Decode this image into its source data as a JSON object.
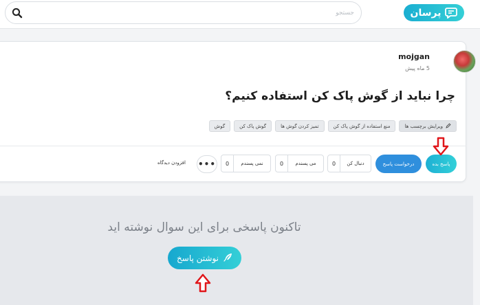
{
  "header": {
    "search_placeholder": "جستجو",
    "logo_text": "پرسان"
  },
  "question": {
    "author": "mojgan",
    "time": "5 ماه پیش",
    "title": "چرا نباید از گوش پاک کن استفاده کنیم؟",
    "tags": [
      "گوش",
      "گوش پاک کن",
      "تمیز کردن گوش ها",
      "منع استفاده از گوش پاک کن"
    ],
    "edit_tags_label": "ویرایش برچسب ها"
  },
  "actions": {
    "answer_label": "پاسخ بده",
    "request_answer_label": "درخواست پاسخ",
    "follow_count": "0",
    "follow_label": "دنبال کن",
    "like_count": "0",
    "like_label": "می پسندم",
    "dislike_count": "0",
    "dislike_label": "نمی پسندم",
    "more_label": "•••",
    "add_comment_label": "افزودن دیدگاه"
  },
  "answers": {
    "empty_message": "تاکنون پاسخی برای این سوال نوشته اید",
    "write_answer_label": "نوشتن پاسخ"
  },
  "colors": {
    "accent_gradient_start": "#17a8cf",
    "accent_gradient_end": "#34cfd7",
    "request_blue": "#2f8fdd",
    "annotation_red": "#e0161a"
  },
  "icons": {
    "search": "search-icon",
    "logo": "chat-bubble-icon",
    "edit": "pencil-icon",
    "write": "feather-icon",
    "annotation": "arrow-down-icon"
  }
}
